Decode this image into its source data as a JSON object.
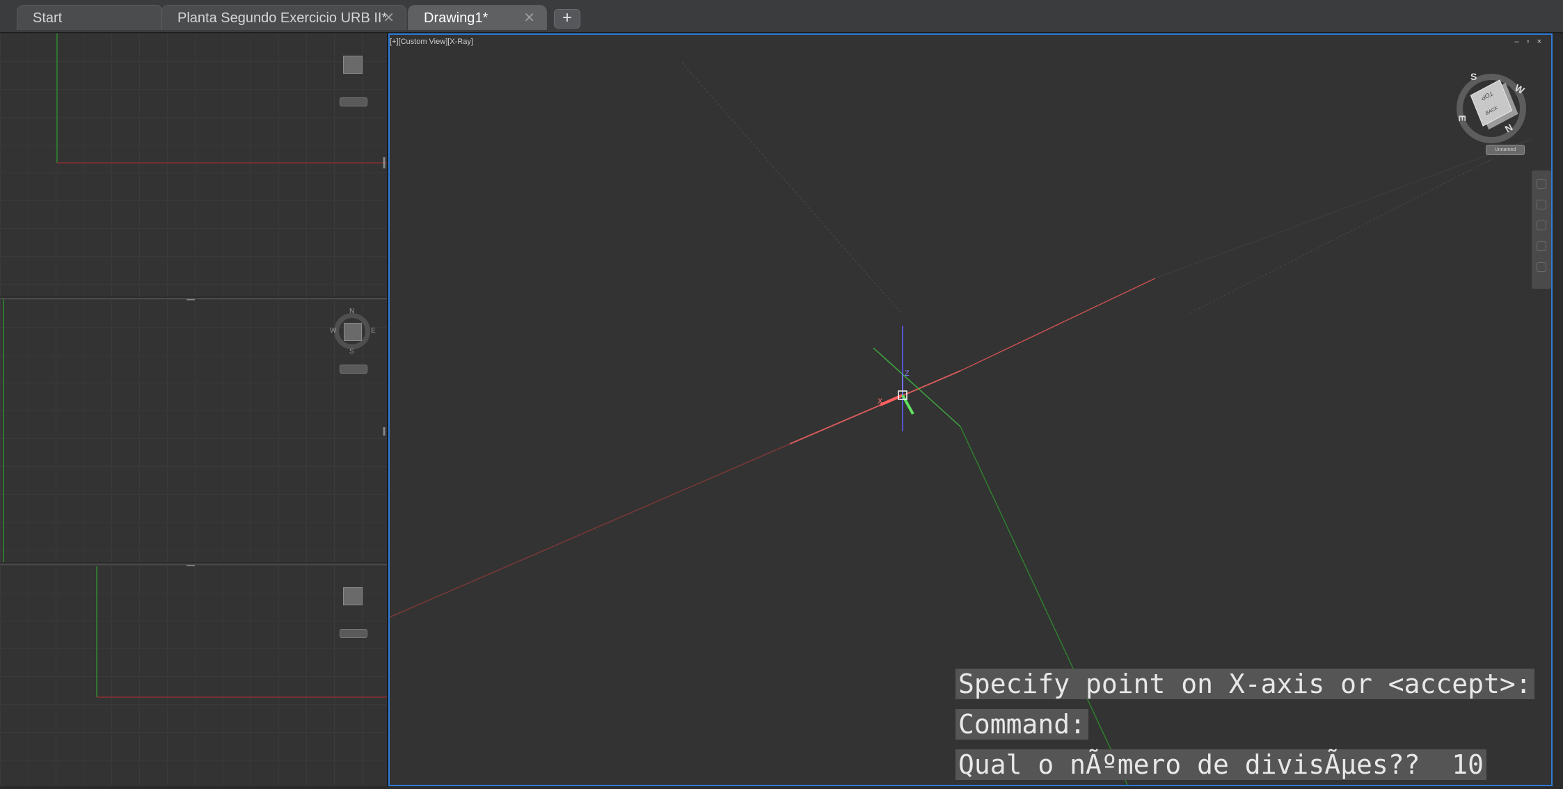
{
  "tabs": [
    {
      "label": "Start",
      "closable": false,
      "active": false
    },
    {
      "label": "Planta Segundo Exercicio URB II*",
      "closable": true,
      "active": false
    },
    {
      "label": "Drawing1*",
      "closable": true,
      "active": true
    }
  ],
  "new_tab_label": "+",
  "close_glyph": "✕",
  "viewport": {
    "label": "[+][Custom View][X-Ray]",
    "controls": "– ▫ ×"
  },
  "viewcube": {
    "top_face": "TOP",
    "back_face": "BACK",
    "ring_letters": [
      "S",
      "W",
      "N",
      "E"
    ],
    "wcs_label": "Unnamed"
  },
  "left_viewports": {
    "compass_letters": [
      "N",
      "W",
      "E",
      "S"
    ]
  },
  "ucs_icon": {
    "x_label": "X",
    "z_label": "Z"
  },
  "command_history": [
    "Specify point on X-axis or <accept>:",
    "Command:",
    "Qual o nÃºmero de divisÃµes??  10"
  ],
  "colors": {
    "x_axis": "#d65a5a",
    "y_axis": "#4fc24f",
    "z_axis": "#6a6aff",
    "active_border": "#2e7bd6",
    "background": "#333333"
  },
  "icons": [
    "close-icon",
    "plus-icon",
    "viewcube",
    "compass",
    "ucs-icon",
    "minimize-icon",
    "restore-icon"
  ]
}
